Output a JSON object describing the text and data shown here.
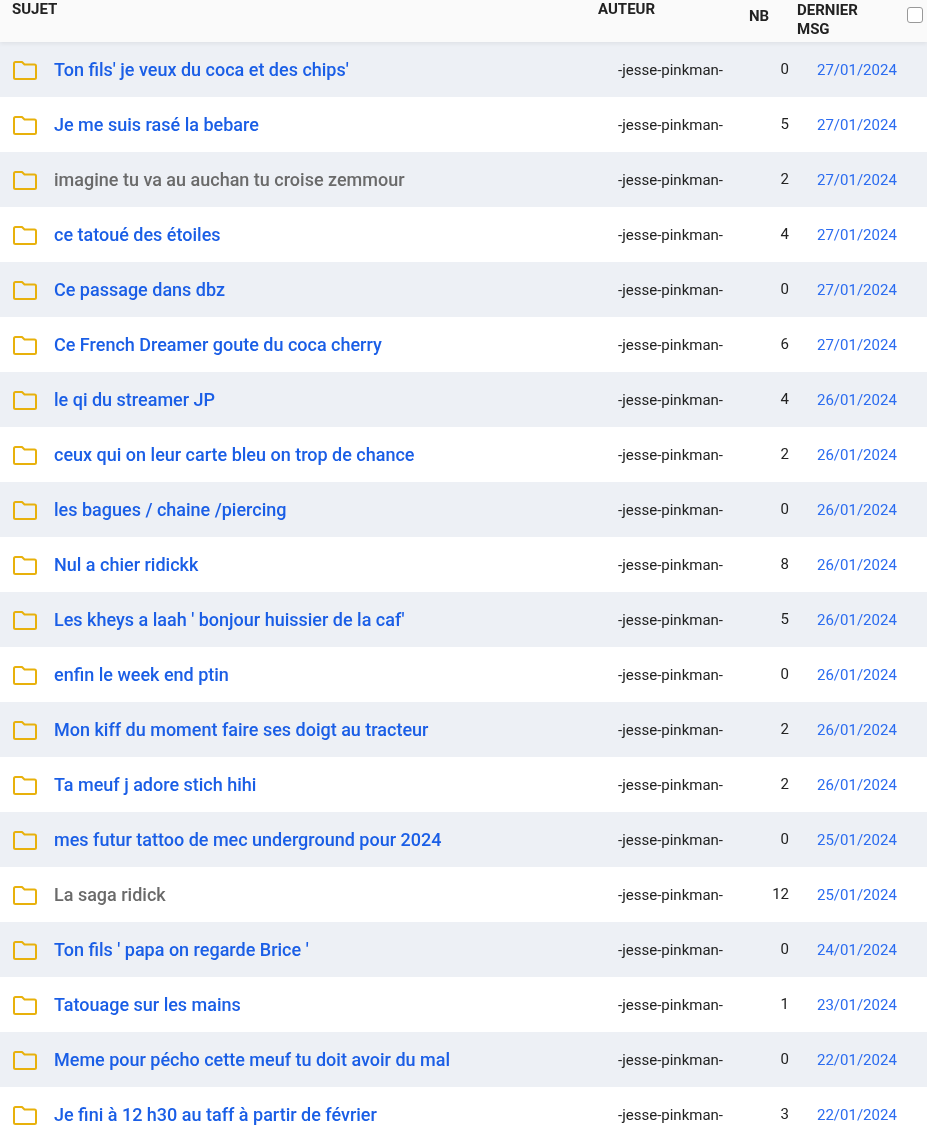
{
  "table": {
    "columns": [
      "SUJET",
      "AUTEUR",
      "NB",
      "DERNIER MSG"
    ],
    "select_all": {
      "checked": false
    },
    "rows": [
      {
        "title": "Ton fils' je veux du coca et des chips'",
        "visited": false,
        "author": "-jesse-pinkman-",
        "count": "0",
        "date": "27/01/2024"
      },
      {
        "title": "Je me suis rasé la bebare",
        "visited": false,
        "author": "-jesse-pinkman-",
        "count": "5",
        "date": "27/01/2024"
      },
      {
        "title": "imagine tu va au auchan tu croise zemmour",
        "visited": true,
        "author": "-jesse-pinkman-",
        "count": "2",
        "date": "27/01/2024"
      },
      {
        "title": "ce tatoué des étoiles",
        "visited": false,
        "author": "-jesse-pinkman-",
        "count": "4",
        "date": "27/01/2024"
      },
      {
        "title": "Ce passage dans dbz",
        "visited": false,
        "author": "-jesse-pinkman-",
        "count": "0",
        "date": "27/01/2024"
      },
      {
        "title": "Ce French Dreamer goute du coca cherry",
        "visited": false,
        "author": "-jesse-pinkman-",
        "count": "6",
        "date": "27/01/2024"
      },
      {
        "title": "le qi du streamer JP",
        "visited": false,
        "author": "-jesse-pinkman-",
        "count": "4",
        "date": "26/01/2024"
      },
      {
        "title": "ceux qui on leur carte bleu on trop de chance",
        "visited": false,
        "author": "-jesse-pinkman-",
        "count": "2",
        "date": "26/01/2024"
      },
      {
        "title": "les bagues / chaine /piercing",
        "visited": false,
        "author": "-jesse-pinkman-",
        "count": "0",
        "date": "26/01/2024"
      },
      {
        "title": "Nul a chier ridickk",
        "visited": false,
        "author": "-jesse-pinkman-",
        "count": "8",
        "date": "26/01/2024"
      },
      {
        "title": "Les kheys a laah ' bonjour huissier de la caf'",
        "visited": false,
        "author": "-jesse-pinkman-",
        "count": "5",
        "date": "26/01/2024"
      },
      {
        "title": "enfin le week end ptin",
        "visited": false,
        "author": "-jesse-pinkman-",
        "count": "0",
        "date": "26/01/2024"
      },
      {
        "title": "Mon kiff du moment faire ses doigt au tracteur",
        "visited": false,
        "author": "-jesse-pinkman-",
        "count": "2",
        "date": "26/01/2024"
      },
      {
        "title": "Ta meuf j adore stich hihi",
        "visited": false,
        "author": "-jesse-pinkman-",
        "count": "2",
        "date": "26/01/2024"
      },
      {
        "title": "mes futur tattoo de mec underground pour 2024",
        "visited": false,
        "author": "-jesse-pinkman-",
        "count": "0",
        "date": "25/01/2024"
      },
      {
        "title": "La saga ridick",
        "visited": true,
        "author": "-jesse-pinkman-",
        "count": "12",
        "date": "25/01/2024"
      },
      {
        "title": "Ton fils ' papa on regarde Brice '",
        "visited": false,
        "author": "-jesse-pinkman-",
        "count": "0",
        "date": "24/01/2024"
      },
      {
        "title": "Tatouage sur les mains",
        "visited": false,
        "author": "-jesse-pinkman-",
        "count": "1",
        "date": "23/01/2024"
      },
      {
        "title": "Meme pour pécho cette meuf tu doit avoir du mal",
        "visited": false,
        "author": "-jesse-pinkman-",
        "count": "0",
        "date": "22/01/2024"
      },
      {
        "title": "Je fini à 12 h30 au taff à partir de février",
        "visited": false,
        "author": "-jesse-pinkman-",
        "count": "3",
        "date": "22/01/2024"
      }
    ]
  }
}
